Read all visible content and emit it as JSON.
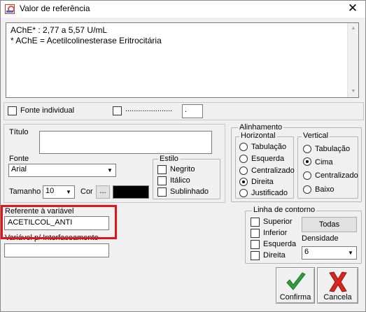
{
  "window": {
    "title": "Valor de referência",
    "close_glyph": "✕"
  },
  "reference_text": {
    "lines": [
      "AChE* : 2,77 a 5,57 U/mL",
      "* AChE = Acetilcolinesterase Eritrocitária"
    ]
  },
  "options_row": {
    "fonte_individual_label": "Fonte individual",
    "dotted_label": "......................",
    "small_field_value": "."
  },
  "titulo": {
    "label": "Título",
    "value": ""
  },
  "fonte": {
    "label": "Fonte",
    "value": "Arial"
  },
  "tamanho": {
    "label": "Tamanho",
    "value": "10"
  },
  "cor": {
    "label": "Cor",
    "button": "...",
    "swatch_color": "#000000"
  },
  "estilo": {
    "title": "Estilo",
    "items": [
      {
        "label": "Negrito",
        "checked": false
      },
      {
        "label": "Itálico",
        "checked": false
      },
      {
        "label": "Sublinhado",
        "checked": false
      }
    ]
  },
  "alinhamento": {
    "title": "Alinhamento",
    "horizontal": {
      "title": "Horizontal",
      "options": [
        "Tabulação",
        "Esquerda",
        "Centralizado",
        "Direita",
        "Justificado"
      ],
      "selected": "Direita"
    },
    "vertical": {
      "title": "Vertical",
      "options": [
        "Tabulação",
        "Cima",
        "Centralizado",
        "Baixo"
      ],
      "selected": "Cima"
    }
  },
  "variavel": {
    "label": "Referente à variável",
    "value": "ACETILCOL_ANTI"
  },
  "interfaceamento": {
    "label": "Variável p/ Interfaceamento",
    "value": ""
  },
  "linha_contorno": {
    "title": "Linha de contorno",
    "items": [
      {
        "label": "Superior",
        "checked": false
      },
      {
        "label": "Inferior",
        "checked": false
      },
      {
        "label": "Esquerda",
        "checked": false
      },
      {
        "label": "Direita",
        "checked": false
      }
    ],
    "todas_button": "Todas",
    "densidade_label": "Densidade",
    "densidade_value": "6"
  },
  "actions": {
    "confirm": "Confirma",
    "cancel": "Cancela"
  },
  "colors": {
    "highlight": "#e0141a",
    "confirm_check": "#2e9e3a",
    "cancel_x": "#d9261c"
  }
}
